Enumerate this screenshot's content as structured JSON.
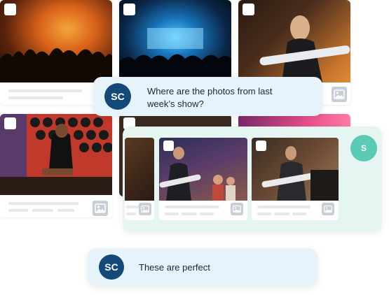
{
  "messages": {
    "question": {
      "avatar_initials": "SC",
      "text_line1": "Where are the photos from last",
      "text_line2": "week’s show?"
    },
    "reply": {
      "avatar_initials": "SC",
      "text": "These are perfect"
    },
    "shared_avatar_initial": "S"
  },
  "icons": {
    "image_placeholder": "image-icon",
    "checkbox": "checkbox-icon"
  },
  "colors": {
    "avatar_dark": "#134a78",
    "avatar_teal": "#5bcab6",
    "bubble_bg": "#e7f3fb",
    "panel_bg": "#e4f5f2"
  }
}
